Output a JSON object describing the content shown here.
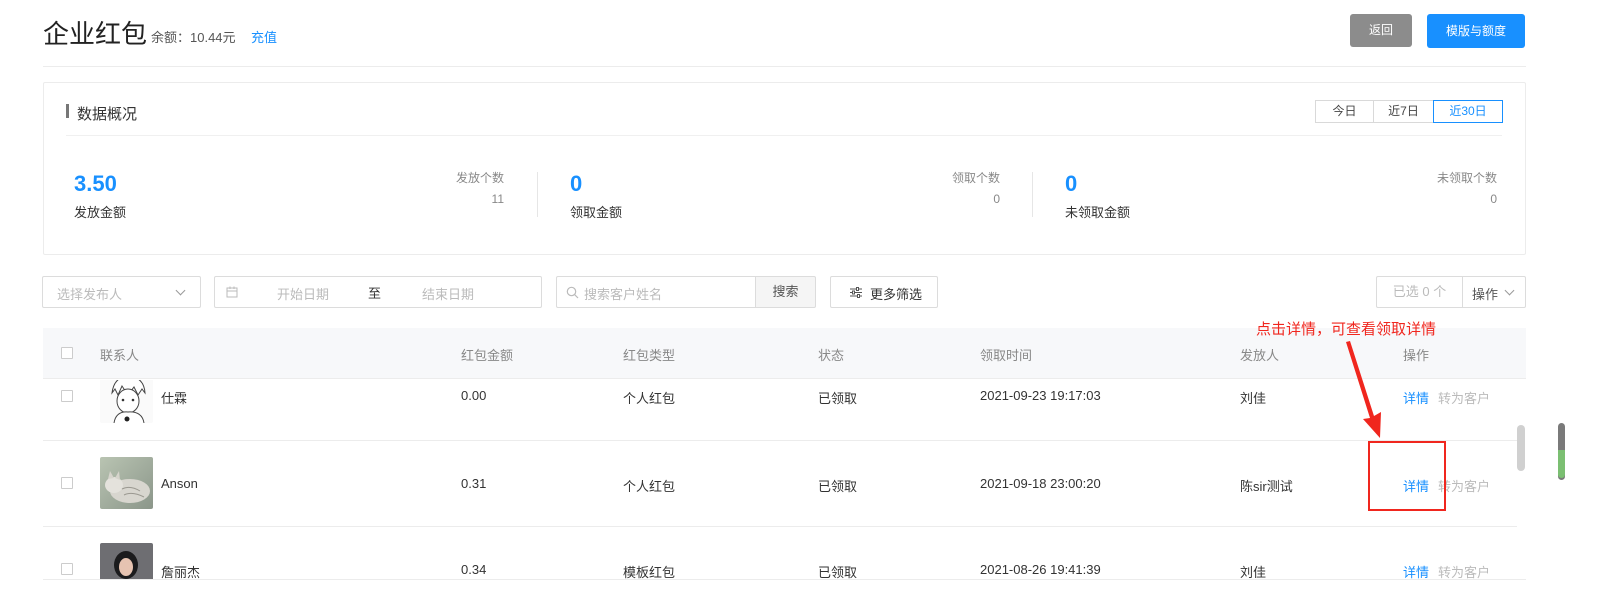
{
  "header": {
    "title": "企业红包",
    "balance": "余额：10.44元",
    "recharge_label": "充值",
    "back_label": "返回",
    "template_label": "模版与额度"
  },
  "overview": {
    "title": "数据概况",
    "ranges": [
      "今日",
      "近7日",
      "近30日"
    ],
    "active_range": "近30日",
    "stats": [
      {
        "value": "3.50",
        "label": "发放金额",
        "side_label": "发放个数",
        "side_value": "11"
      },
      {
        "value": "0",
        "label": "领取金额",
        "side_label": "领取个数",
        "side_value": "0"
      },
      {
        "value": "0",
        "label": "未领取金额",
        "side_label": "未领取个数",
        "side_value": "0"
      }
    ]
  },
  "filters": {
    "sender_placeholder": "选择发布人",
    "start_date_placeholder": "开始日期",
    "date_separator": "至",
    "end_date_placeholder": "结束日期",
    "search_placeholder": "搜索客户姓名",
    "search_button": "搜索",
    "more_filters": "更多筛选",
    "selected_count": "已选 0 个",
    "actions": "操作"
  },
  "table": {
    "columns": [
      "联系人",
      "红包金额",
      "红包类型",
      "状态",
      "领取时间",
      "发放人",
      "操作"
    ],
    "rows": [
      {
        "name": "仕霖",
        "amount": "0.00",
        "type": "个人红包",
        "status": "已领取",
        "time": "2021-09-23 19:17:03",
        "sender": "刘佳",
        "detail": "详情",
        "convert": "转为客户"
      },
      {
        "name": "Anson",
        "amount": "0.31",
        "type": "个人红包",
        "status": "已领取",
        "time": "2021-09-18 23:00:20",
        "sender": "陈sir测试",
        "detail": "详情",
        "convert": "转为客户"
      },
      {
        "name": "詹丽杰",
        "amount": "0.34",
        "type": "模板红包",
        "status": "已领取",
        "time": "2021-08-26 19:41:39",
        "sender": "刘佳",
        "detail": "详情",
        "convert": "转为客户"
      }
    ]
  },
  "annotation": {
    "text": "点击详情，可查看领取详情",
    "color": "#f0261e"
  },
  "colors": {
    "accent": "#1890ff",
    "back_button": "#8c8c8c"
  }
}
